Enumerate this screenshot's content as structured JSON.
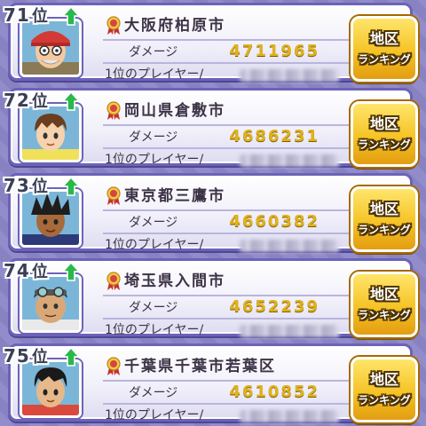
{
  "labels": {
    "damage": "ダメージ",
    "top_player": "1位のプレイヤー/",
    "rank_suffix": "位",
    "region_button_line1": "地区",
    "region_button_line2": "ランキング"
  },
  "rows": [
    {
      "rank": "71",
      "city": "大阪府柏原市",
      "damage": "4711965",
      "icon": "old-man-red-cap-avatar"
    },
    {
      "rank": "72",
      "city": "岡山県倉敷市",
      "damage": "4686231",
      "icon": "boy-brown-hair-avatar"
    },
    {
      "rank": "73",
      "city": "東京都三鷹市",
      "damage": "4660382",
      "icon": "tan-boy-spiky-hair-avatar"
    },
    {
      "rank": "74",
      "city": "埼玉県入間市",
      "damage": "4652239",
      "icon": "man-goggles-avatar"
    },
    {
      "rank": "75",
      "city": "千葉県千葉市若葉区",
      "damage": "4610852",
      "icon": "boy-black-hair-avatar"
    }
  ],
  "colors": {
    "background": "#8d86c8",
    "card_border": "#6c63b8",
    "damage_value": "#e0b11c",
    "button_yellow": "#f5c326",
    "arrow_green": "#29b84a",
    "medal_red": "#d6453d"
  }
}
